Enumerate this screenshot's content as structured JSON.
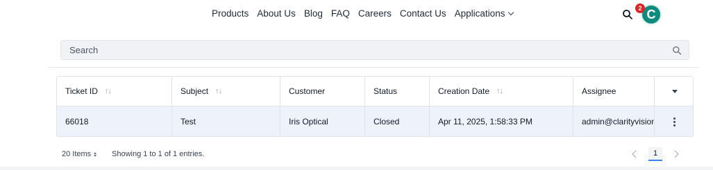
{
  "nav": {
    "links": [
      "Products",
      "About Us",
      "Blog",
      "FAQ",
      "Careers",
      "Contact Us",
      "Applications"
    ],
    "notification_count": "2",
    "avatar_initial": "C",
    "accent_color": "#0e8a7e",
    "icons": {
      "search": "search-icon",
      "dropdown": "chevron-down-icon"
    }
  },
  "search": {
    "placeholder": "Search",
    "value": ""
  },
  "table": {
    "columns": [
      "Ticket ID",
      "Subject",
      "Customer",
      "Status",
      "Creation Date",
      "Assignee"
    ],
    "sortable": [
      "Ticket ID",
      "Subject",
      "Creation Date"
    ],
    "rows": [
      {
        "ticket_id": "66018",
        "subject": "Test",
        "customer": "Iris Optical",
        "status": "Closed",
        "creation_date": "Apr 11, 2025, 1:58:33 PM",
        "assignee": "admin@clarityvisionsolutions"
      }
    ]
  },
  "footer": {
    "items_per_page": "20 Items",
    "showing": "Showing 1 to 1 of 1 entries.",
    "current_page": "1"
  }
}
